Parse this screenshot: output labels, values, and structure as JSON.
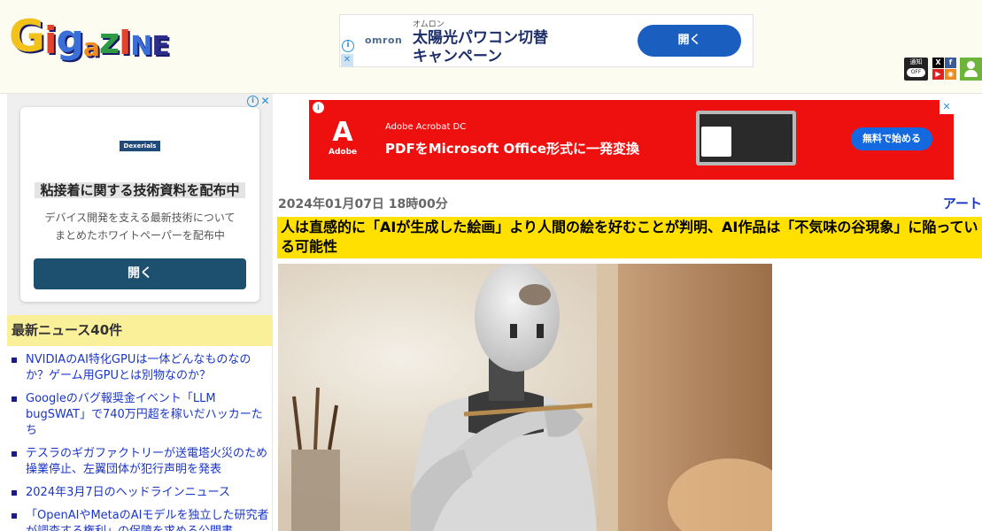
{
  "header": {
    "logo_letters": [
      "G",
      "i",
      "g",
      "a",
      "z",
      "I",
      "N",
      "E"
    ],
    "top_ad": {
      "brand": "omron",
      "sub_label": "オムロン",
      "headline_line1": "太陽光パワコン切替",
      "headline_line2": "キャンペーン",
      "button": "開く"
    },
    "notify_label": "通知",
    "notify_state": "OFF",
    "social": {
      "x": "X",
      "facebook": "f",
      "youtube": "▶",
      "rss": "◉"
    }
  },
  "sidebar": {
    "ad": {
      "logo": "Dexerials",
      "title": "粘接着に関する技術資料を配布中",
      "desc_line1": "デバイス開発を支える最新技術について",
      "desc_line2": "まとめたホワイトペーパーを配布中",
      "button": "開く"
    },
    "news_heading": "最新ニュース40件",
    "news": [
      "NVIDIAのAI特化GPUは一体どんなものなのか？ゲーム用GPUとは別物なのか？",
      "Googleのバグ報奨金イベント「LLM bugSWAT」で740万円超を稼いだハッカーたち",
      "テスラのギガファクトリーが送電塔火災のため操業停止、左翼団体が犯行声明を発表",
      "2024年3月7日のヘッドラインニュース",
      "「OpenAIやMetaのAIモデルを独立した研究者が調査する権利」の保障を求める公開書"
    ]
  },
  "main": {
    "ad": {
      "brand": "Adobe",
      "product": "Adobe Acrobat DC",
      "headline": "PDFをMicrosoft Office形式に一発変換",
      "cta": "無料で始める"
    },
    "date": "2024年01月07日 18時00分",
    "category": "アート",
    "title": "人は直感的に「AIが生成した絵画」より人間の絵を好むことが判明、AI作品は「不気味の谷現象」に陥っている可能性"
  },
  "colors": {
    "header_bg": "#fcfcf0",
    "title_highlight": "#ffe000",
    "news_heading_bg": "#fbf09a",
    "link": "#1a35c8",
    "adobe_red": "#ee0f0f"
  }
}
